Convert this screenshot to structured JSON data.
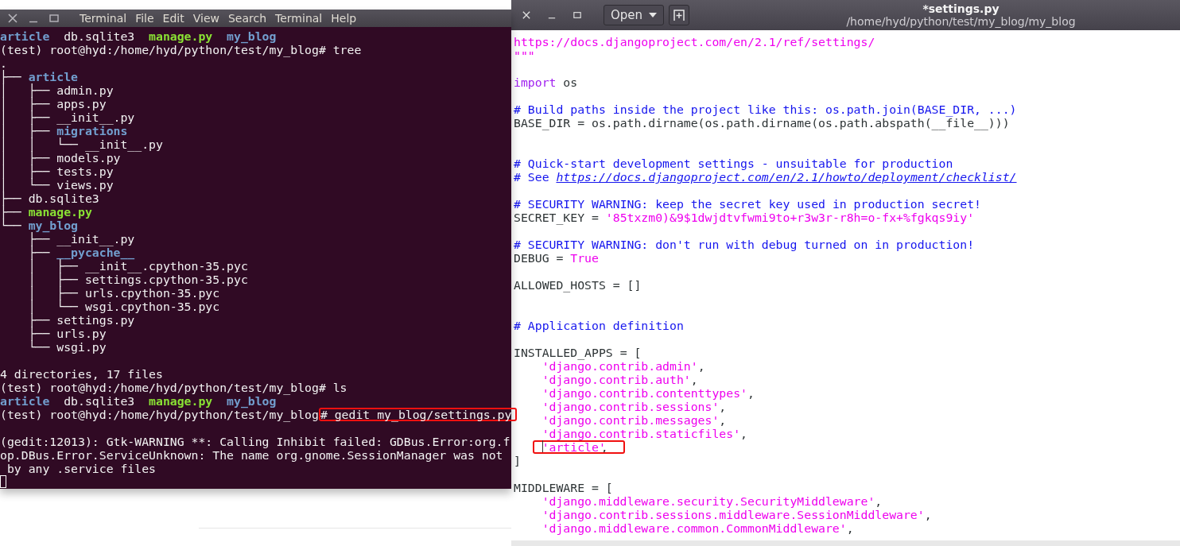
{
  "terminal": {
    "menu": [
      "Terminal",
      "File",
      "Edit",
      "View",
      "Search",
      "Terminal",
      "Help"
    ],
    "lines": [
      {
        "kind": "text",
        "segments": [
          {
            "text": "article",
            "kind": "dir"
          },
          {
            "text": "  db.sqlite3",
            "kind": "plain"
          },
          {
            "text": "  manage.py",
            "kind": "exec"
          },
          {
            "text": "  my_blog",
            "kind": "dir"
          }
        ]
      },
      {
        "kind": "text",
        "segments": [
          {
            "text": "(test) root@hyd:/home/hyd/python/test/my_blog# tree",
            "kind": "plain"
          }
        ]
      },
      {
        "kind": "text",
        "segments": [
          {
            "text": ".",
            "kind": "plain"
          }
        ]
      },
      {
        "kind": "text",
        "segments": [
          {
            "text": "├── ",
            "kind": "plain"
          },
          {
            "text": "article",
            "kind": "dir"
          }
        ]
      },
      {
        "kind": "text",
        "segments": [
          {
            "text": "│   ├── admin.py",
            "kind": "plain"
          }
        ]
      },
      {
        "kind": "text",
        "segments": [
          {
            "text": "│   ├── apps.py",
            "kind": "plain"
          }
        ]
      },
      {
        "kind": "text",
        "segments": [
          {
            "text": "│   ├── __init__.py",
            "kind": "plain"
          }
        ]
      },
      {
        "kind": "text",
        "segments": [
          {
            "text": "│   ├── ",
            "kind": "plain"
          },
          {
            "text": "migrations",
            "kind": "dir"
          }
        ]
      },
      {
        "kind": "text",
        "segments": [
          {
            "text": "│   │   └── __init__.py",
            "kind": "plain"
          }
        ]
      },
      {
        "kind": "text",
        "segments": [
          {
            "text": "│   ├── models.py",
            "kind": "plain"
          }
        ]
      },
      {
        "kind": "text",
        "segments": [
          {
            "text": "│   ├── tests.py",
            "kind": "plain"
          }
        ]
      },
      {
        "kind": "text",
        "segments": [
          {
            "text": "│   └── views.py",
            "kind": "plain"
          }
        ]
      },
      {
        "kind": "text",
        "segments": [
          {
            "text": "├── db.sqlite3",
            "kind": "plain"
          }
        ]
      },
      {
        "kind": "text",
        "segments": [
          {
            "text": "├── ",
            "kind": "plain"
          },
          {
            "text": "manage.py",
            "kind": "exec"
          }
        ]
      },
      {
        "kind": "text",
        "segments": [
          {
            "text": "└── ",
            "kind": "plain"
          },
          {
            "text": "my_blog",
            "kind": "dir"
          }
        ]
      },
      {
        "kind": "text",
        "segments": [
          {
            "text": "    ├── __init__.py",
            "kind": "plain"
          }
        ]
      },
      {
        "kind": "text",
        "segments": [
          {
            "text": "    ├── ",
            "kind": "plain"
          },
          {
            "text": "__pycache__",
            "kind": "dir"
          }
        ]
      },
      {
        "kind": "text",
        "segments": [
          {
            "text": "    │   ├── __init__.cpython-35.pyc",
            "kind": "plain"
          }
        ]
      },
      {
        "kind": "text",
        "segments": [
          {
            "text": "    │   ├── settings.cpython-35.pyc",
            "kind": "plain"
          }
        ]
      },
      {
        "kind": "text",
        "segments": [
          {
            "text": "    │   ├── urls.cpython-35.pyc",
            "kind": "plain"
          }
        ]
      },
      {
        "kind": "text",
        "segments": [
          {
            "text": "    │   └── wsgi.cpython-35.pyc",
            "kind": "plain"
          }
        ]
      },
      {
        "kind": "text",
        "segments": [
          {
            "text": "    ├── settings.py",
            "kind": "plain"
          }
        ]
      },
      {
        "kind": "text",
        "segments": [
          {
            "text": "    ├── urls.py",
            "kind": "plain"
          }
        ]
      },
      {
        "kind": "text",
        "segments": [
          {
            "text": "    └── wsgi.py",
            "kind": "plain"
          }
        ]
      },
      {
        "kind": "blank"
      },
      {
        "kind": "text",
        "segments": [
          {
            "text": "4 directories, 17 files",
            "kind": "plain"
          }
        ]
      },
      {
        "kind": "text",
        "segments": [
          {
            "text": "(test) root@hyd:/home/hyd/python/test/my_blog# ls",
            "kind": "plain"
          }
        ]
      },
      {
        "kind": "text",
        "segments": [
          {
            "text": "article",
            "kind": "dir"
          },
          {
            "text": "  db.sqlite3",
            "kind": "plain"
          },
          {
            "text": "  manage.py",
            "kind": "exec"
          },
          {
            "text": "  my_blog",
            "kind": "dir"
          }
        ]
      },
      {
        "kind": "text",
        "segments": [
          {
            "text": "(test) root@hyd:/home/hyd/python/test/my_blog",
            "kind": "plain"
          },
          {
            "text": "# gedit my_blog/settings.py",
            "kind": "plain",
            "highlighted": true
          }
        ]
      },
      {
        "kind": "blank"
      },
      {
        "kind": "text",
        "segments": [
          {
            "text": "(gedit:12013): Gtk-WARNING **: Calling Inhibit failed: GDBus.Error:org.f",
            "kind": "plain"
          }
        ]
      },
      {
        "kind": "text",
        "segments": [
          {
            "text": "op.DBus.Error.ServiceUnknown: The name org.gnome.SessionManager was not",
            "kind": "plain"
          }
        ]
      },
      {
        "kind": "text",
        "segments": [
          {
            "text": " by any .service files",
            "kind": "plain"
          }
        ]
      }
    ],
    "cursor": true
  },
  "editor": {
    "open_button": "Open",
    "title": "*settings.py",
    "subtitle": "/home/hyd/python/test/my_blog/my_blog",
    "lines": [
      {
        "kind": "text",
        "segments": [
          {
            "text": "https://docs.djangoproject.com/en/2.1/ref/settings/",
            "kind": "string"
          }
        ]
      },
      {
        "kind": "text",
        "segments": [
          {
            "text": "\"\"\"",
            "kind": "string"
          }
        ]
      },
      {
        "kind": "blank"
      },
      {
        "kind": "text",
        "segments": [
          {
            "text": "import",
            "kind": "keyword"
          },
          {
            "text": " os",
            "kind": "plain"
          }
        ]
      },
      {
        "kind": "blank"
      },
      {
        "kind": "text",
        "segments": [
          {
            "text": "# Build paths inside the project like this: os.path.join(BASE_DIR, ...)",
            "kind": "comment"
          }
        ]
      },
      {
        "kind": "text",
        "segments": [
          {
            "text": "BASE_DIR = os.path.dirname(os.path.dirname(os.path.abspath(__file__)))",
            "kind": "plain"
          }
        ]
      },
      {
        "kind": "blank"
      },
      {
        "kind": "blank"
      },
      {
        "kind": "text",
        "segments": [
          {
            "text": "# Quick-start development settings - unsuitable for production",
            "kind": "comment"
          }
        ]
      },
      {
        "kind": "text",
        "segments": [
          {
            "text": "# See ",
            "kind": "comment"
          },
          {
            "text": "https://docs.djangoproject.com/en/2.1/howto/deployment/checklist/",
            "kind": "link"
          }
        ]
      },
      {
        "kind": "blank"
      },
      {
        "kind": "text",
        "segments": [
          {
            "text": "# SECURITY WARNING: keep the secret key used in production secret!",
            "kind": "comment"
          }
        ]
      },
      {
        "kind": "text",
        "segments": [
          {
            "text": "SECRET_KEY = ",
            "kind": "plain"
          },
          {
            "text": "'85txzm0)&9$1dwjdtvfwmi9to+r3w3r-r8h=o-fx+%fgkqs9iy'",
            "kind": "string"
          }
        ]
      },
      {
        "kind": "blank"
      },
      {
        "kind": "text",
        "segments": [
          {
            "text": "# SECURITY WARNING: don't run with debug turned on in production!",
            "kind": "comment"
          }
        ]
      },
      {
        "kind": "text",
        "segments": [
          {
            "text": "DEBUG = ",
            "kind": "plain"
          },
          {
            "text": "True",
            "kind": "string"
          }
        ]
      },
      {
        "kind": "blank"
      },
      {
        "kind": "text",
        "segments": [
          {
            "text": "ALLOWED_HOSTS = []",
            "kind": "plain"
          }
        ]
      },
      {
        "kind": "blank"
      },
      {
        "kind": "blank"
      },
      {
        "kind": "text",
        "segments": [
          {
            "text": "# Application definition",
            "kind": "comment"
          }
        ]
      },
      {
        "kind": "blank"
      },
      {
        "kind": "text",
        "segments": [
          {
            "text": "INSTALLED_APPS = [",
            "kind": "plain"
          }
        ]
      },
      {
        "kind": "text",
        "indented": true,
        "segments": [
          {
            "text": "'django.contrib.admin'",
            "kind": "string"
          },
          {
            "text": ",",
            "kind": "plain"
          }
        ]
      },
      {
        "kind": "text",
        "indented": true,
        "segments": [
          {
            "text": "'django.contrib.auth'",
            "kind": "string"
          },
          {
            "text": ",",
            "kind": "plain"
          }
        ]
      },
      {
        "kind": "text",
        "indented": true,
        "segments": [
          {
            "text": "'django.contrib.contenttypes'",
            "kind": "string"
          },
          {
            "text": ",",
            "kind": "plain"
          }
        ]
      },
      {
        "kind": "text",
        "indented": true,
        "segments": [
          {
            "text": "'django.contrib.sessions'",
            "kind": "string"
          },
          {
            "text": ",",
            "kind": "plain"
          }
        ]
      },
      {
        "kind": "text",
        "indented": true,
        "segments": [
          {
            "text": "'django.contrib.messages'",
            "kind": "string"
          },
          {
            "text": ",",
            "kind": "plain"
          }
        ]
      },
      {
        "kind": "text",
        "indented": true,
        "segments": [
          {
            "text": "'django.contrib.staticfiles'",
            "kind": "string"
          },
          {
            "text": ",",
            "kind": "plain"
          }
        ]
      },
      {
        "kind": "text",
        "indented": true,
        "segments": [
          {
            "text": "'article'",
            "kind": "string",
            "highlighted": true,
            "cursor": true
          },
          {
            "text": ",",
            "kind": "plain"
          }
        ]
      },
      {
        "kind": "text",
        "segments": [
          {
            "text": "]",
            "kind": "plain"
          }
        ]
      },
      {
        "kind": "blank"
      },
      {
        "kind": "text",
        "segments": [
          {
            "text": "MIDDLEWARE = [",
            "kind": "plain"
          }
        ]
      },
      {
        "kind": "text",
        "indented": true,
        "segments": [
          {
            "text": "'django.middleware.security.SecurityMiddleware'",
            "kind": "string"
          },
          {
            "text": ",",
            "kind": "plain"
          }
        ]
      },
      {
        "kind": "text",
        "indented": true,
        "segments": [
          {
            "text": "'django.contrib.sessions.middleware.SessionMiddleware'",
            "kind": "string"
          },
          {
            "text": ",",
            "kind": "plain"
          }
        ]
      },
      {
        "kind": "text",
        "indented": true,
        "segments": [
          {
            "text": "'django.middleware.common.CommonMiddleware'",
            "kind": "string"
          },
          {
            "text": ",",
            "kind": "plain"
          }
        ]
      }
    ]
  }
}
